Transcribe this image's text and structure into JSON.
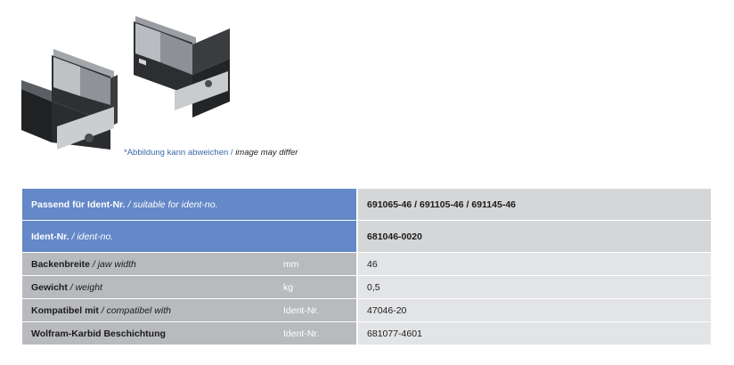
{
  "image_caption": {
    "de": "*Abbildung kann abweichen / ",
    "en": "image may differ"
  },
  "header_rows": [
    {
      "label_de": "Passend für Ident-Nr.",
      "label_en": " / suitable for ident-no.",
      "value": "691065-46 / 691105-46 / 691145-46"
    },
    {
      "label_de": "Ident-Nr.",
      "label_en": " / ident-no.",
      "value": "681046-0020"
    }
  ],
  "rows": [
    {
      "label_de": "Backenbreite",
      "label_en": " / jaw width",
      "unit": "mm",
      "value": "46"
    },
    {
      "label_de": "Gewicht",
      "label_en": " / weight",
      "unit": "kg",
      "value": "0,5"
    },
    {
      "label_de": "Kompatibel mit",
      "label_en": " / compatibel with",
      "unit": "Ident-Nr.",
      "value": "47046-20"
    },
    {
      "label_de": "Wolfram-Karbid Beschichtung",
      "label_en": "",
      "unit": "Ident-Nr.",
      "value": "681077-4601"
    }
  ],
  "colors": {
    "header_label_bg": "#6488c8",
    "header_value_bg": "#d5d6d8",
    "row_label_bg": "#b8babe",
    "row_value_bg": "#e3e4e6"
  }
}
